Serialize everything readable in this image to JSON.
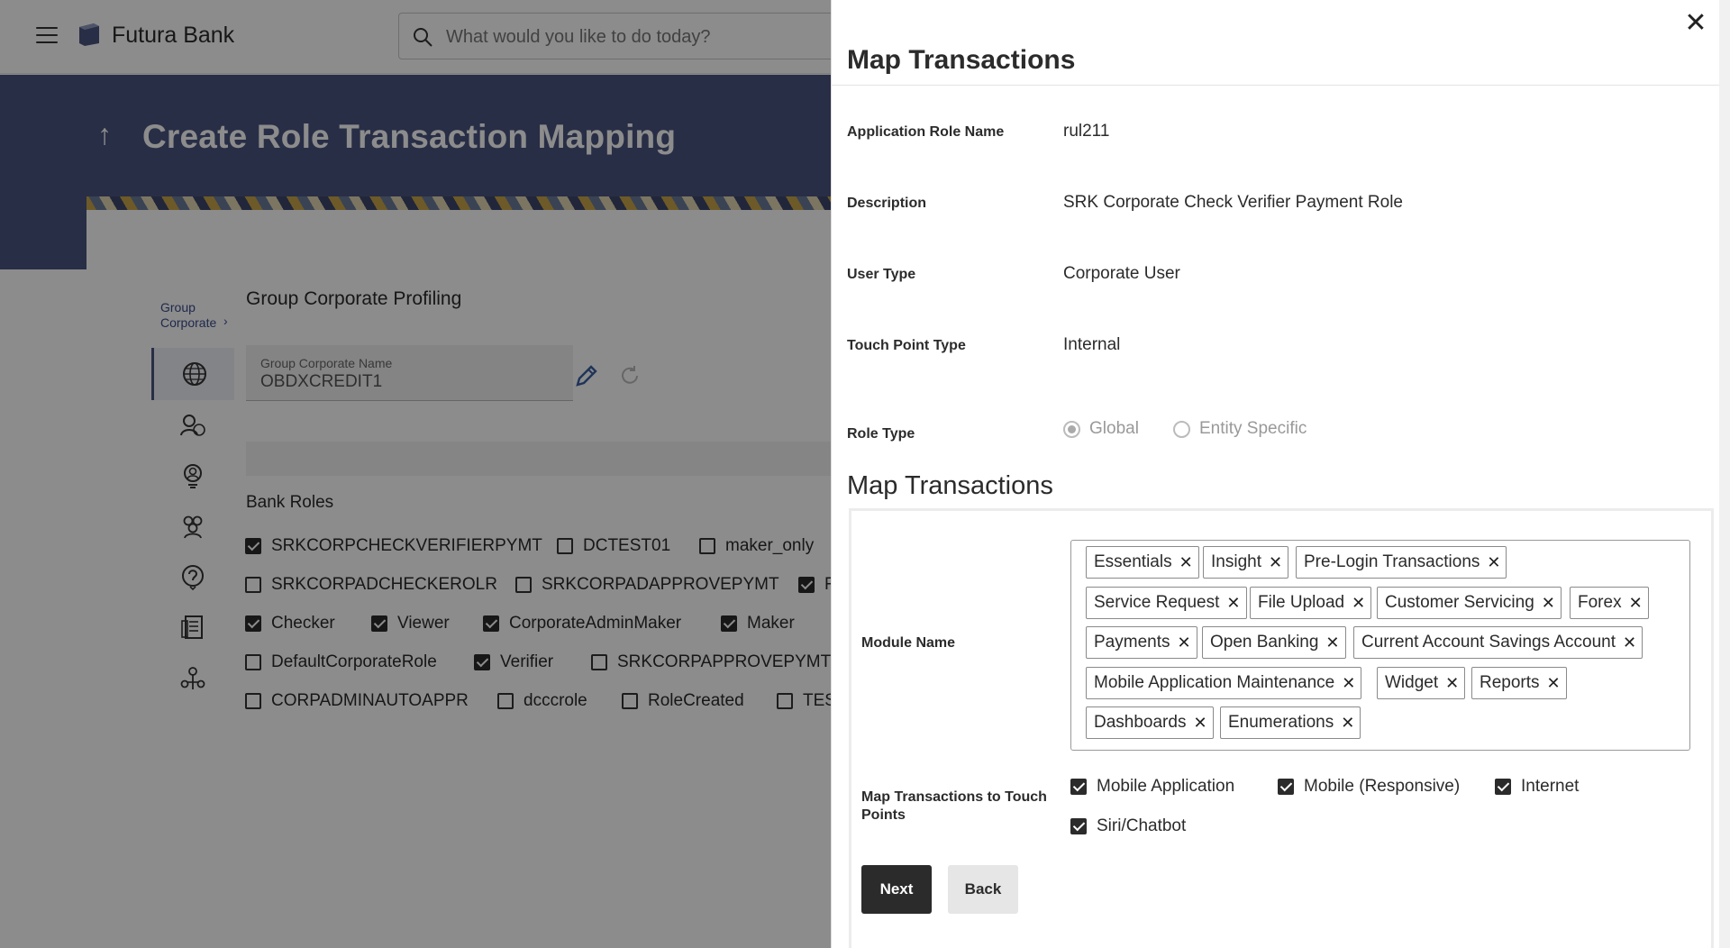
{
  "header": {
    "brand": "Futura Bank",
    "search_placeholder": "What would you like to do today?"
  },
  "page": {
    "title": "Create Role Transaction Mapping",
    "breadcrumb_line1": "Group",
    "breadcrumb_line2": "Corporate",
    "section_title": "Group Corporate Profiling",
    "group_corporate_name_label": "Group Corporate Name",
    "group_corporate_name_value": "OBDXCREDIT1",
    "bank_roles_title": "Bank Roles",
    "bank_roles": [
      {
        "label": "SRKCORPCHECKVERIFIERPYMT",
        "checked": true
      },
      {
        "label": "DCTEST01",
        "checked": false
      },
      {
        "label": "maker_only",
        "checked": false
      },
      {
        "label": "SRKCORPADCHECKEROLR",
        "checked": false
      },
      {
        "label": "SRKCORPADAPPROVEPYMT",
        "checked": false
      },
      {
        "label": "F",
        "checked": true
      },
      {
        "label": "Checker",
        "checked": true
      },
      {
        "label": "Viewer",
        "checked": true
      },
      {
        "label": "CorporateAdminMaker",
        "checked": true
      },
      {
        "label": "Maker",
        "checked": true
      },
      {
        "label": "DefaultCorporateRole",
        "checked": false
      },
      {
        "label": "Verifier",
        "checked": true
      },
      {
        "label": "SRKCORPAPPROVEPYMT",
        "checked": false
      },
      {
        "label": "CORPADMINAUTOAPPR",
        "checked": false
      },
      {
        "label": "dcccrole",
        "checked": false
      },
      {
        "label": "RoleCreated",
        "checked": false
      },
      {
        "label": "TES",
        "checked": false
      }
    ]
  },
  "panel": {
    "title": "Map Transactions",
    "fields": [
      {
        "label": "Application Role Name",
        "value": "rul211"
      },
      {
        "label": "Description",
        "value": "SRK Corporate Check Verifier Payment Role"
      },
      {
        "label": "User Type",
        "value": "Corporate User"
      },
      {
        "label": "Touch Point Type",
        "value": "Internal"
      }
    ],
    "role_type_label": "Role Type",
    "role_type_options": [
      {
        "label": "Global",
        "selected": true
      },
      {
        "label": "Entity Specific",
        "selected": false
      }
    ],
    "map_heading": "Map Transactions",
    "module_name_label": "Module Name",
    "modules": [
      "Essentials",
      "Insight",
      "Pre-Login Transactions",
      "Service Request",
      "File Upload",
      "Customer Servicing",
      "Forex",
      "Payments",
      "Open Banking",
      "Current Account Savings Account",
      "Mobile Application Maintenance",
      "Widget",
      "Reports",
      "Dashboards",
      "Enumerations"
    ],
    "touch_points_label": "Map Transactions to Touch Points",
    "touch_points": [
      {
        "label": "Mobile Application",
        "checked": true
      },
      {
        "label": "Mobile (Responsive)",
        "checked": true
      },
      {
        "label": "Internet",
        "checked": true
      },
      {
        "label": "Siri/Chatbot",
        "checked": true
      }
    ],
    "next_label": "Next",
    "back_label": "Back",
    "close_symbol": "✕",
    "chip_remove_symbol": "✕"
  },
  "icons": [
    "menu-icon",
    "bank-logo-icon",
    "search-icon",
    "up-arrow-icon",
    "globe-icon",
    "users-globe-icon",
    "user-badge-icon",
    "group-icon",
    "support-icon",
    "document-icon",
    "network-icon",
    "edit-icon",
    "refresh-icon",
    "close-icon"
  ],
  "colors": {
    "hero": "#4a5580",
    "primary_button": "#2b2b2b",
    "secondary_button": "#e6e6e6",
    "link": "#3a4c8a"
  }
}
